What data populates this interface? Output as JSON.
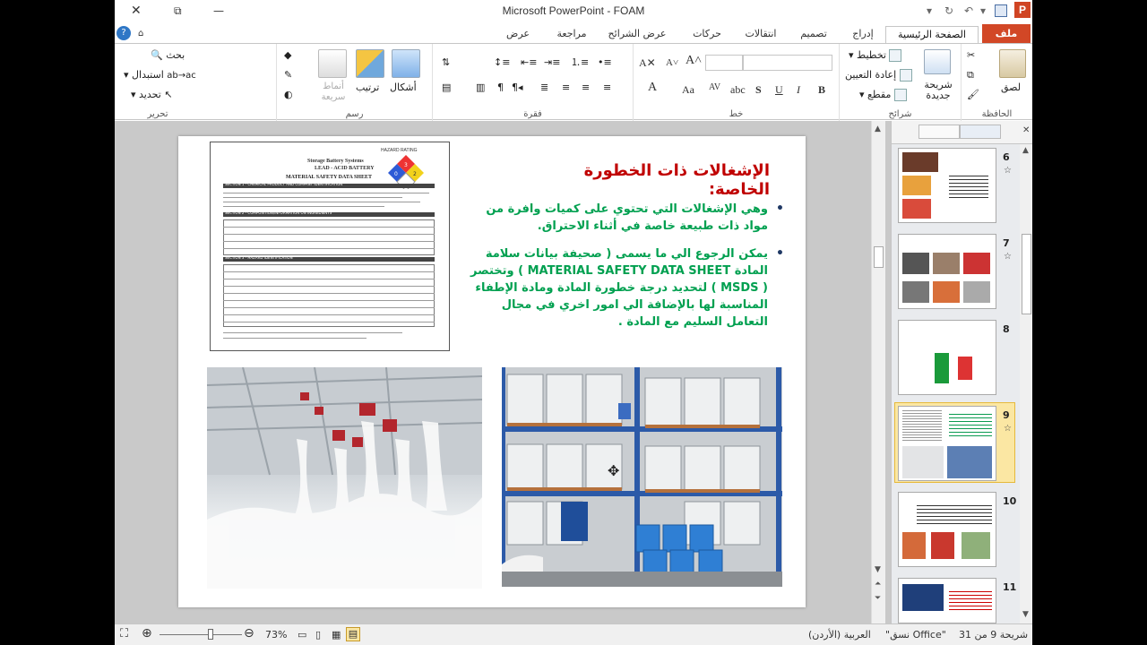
{
  "window": {
    "title": "Microsoft PowerPoint - FOAM",
    "close_glyph": "✕",
    "restore_glyph": "⧉",
    "minimize_glyph": "—",
    "app_badge": "P"
  },
  "tabs": [
    "ملف",
    "الصفحة الرئيسية",
    "إدراج",
    "تصميم",
    "انتقالات",
    "حركات",
    "عرض الشرائح",
    "مراجعة",
    "عرض"
  ],
  "ribbon": {
    "clipboard": {
      "label": "الحافظة",
      "paste": "لصق"
    },
    "slides": {
      "label": "شرائح",
      "new_slide": "شريحة جديدة",
      "layout": "تخطيط",
      "reset": "إعادة التعيين",
      "section": "مقطع"
    },
    "font": {
      "label": "خط"
    },
    "paragraph": {
      "label": "فقرة"
    },
    "drawing": {
      "label": "رسم",
      "shapes": "أشكال",
      "arrange": "ترتيب",
      "quick_styles": "أنماط سريعة"
    },
    "editing": {
      "label": "تحرير",
      "find": "بحث",
      "replace": "استبدال",
      "select": "تحديد"
    }
  },
  "slide": {
    "title": "الإشغالات ذات الخطورة الخاصة:",
    "bullet1": "وهي الإشغالات التي تحتوي على كميات وافرة من مواد ذات طبيعة خاصة في أثناء الاحتراق.",
    "bullet2": "يمكن الرجوع الي ما يسمى ( صحيفة بيانات سلامة المادة MATERIAL SAFETY DATA SHEET ) وتختصر ( MSDS ) لتحديد درجة خطورة المادة ومادة الإطفاء المناسبة لها بالإضافة الي امور اخري في مجال التعامل السليم مع المادة .",
    "sds_doc": {
      "heading1": "Storage Battery Systems",
      "heading2": "LEAD - ACID BATTERY",
      "heading3": "MATERIAL SAFETY DATA SHEET",
      "section1": "SECTION 1 - CHEMICAL PRODUCT AND COMPANY IDENTIFICATION",
      "section2": "SECTION 2 - COMPOSITION/INFORMATION ON INGREDIENTS",
      "section3": "SECTION 3 - HAZARD IDENTIFICATION",
      "hazard_label": "HAZARD RATING",
      "hazard_values": [
        "3",
        "0",
        "2"
      ]
    }
  },
  "thumbnails": [
    {
      "num": "6",
      "star": "☆"
    },
    {
      "num": "7",
      "star": "☆"
    },
    {
      "num": "8",
      "star": ""
    },
    {
      "num": "9",
      "star": "☆"
    },
    {
      "num": "10",
      "star": ""
    },
    {
      "num": "11",
      "star": ""
    }
  ],
  "status": {
    "slide_info": "شريحة 9 من 31",
    "theme": "\"نسق Office\"",
    "language": "العربية (الأردن)",
    "zoom": "73%"
  },
  "colors": {
    "title_red": "#c00000",
    "bullet_green": "#00a050",
    "file_tab": "#d24726",
    "selected_thumb": "#fbe7a3"
  }
}
